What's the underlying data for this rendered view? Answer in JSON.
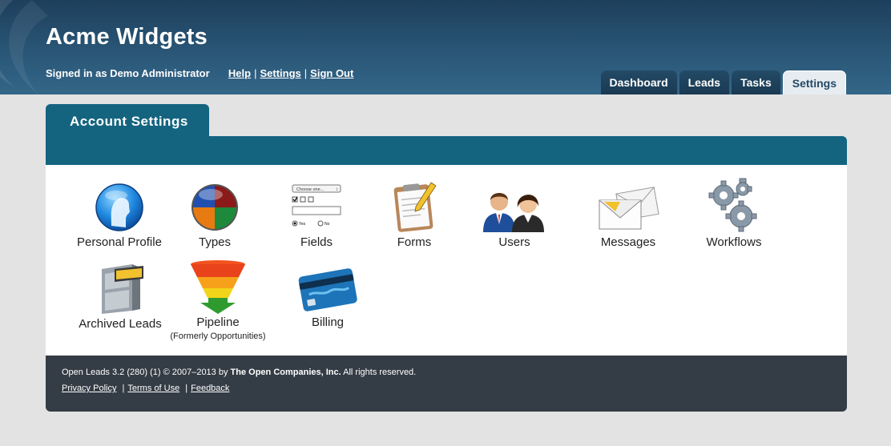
{
  "header": {
    "app_title": "Acme Widgets",
    "signed_in_text": "Signed in as Demo Administrator",
    "links": [
      "Help",
      "Settings",
      "Sign Out"
    ],
    "separator": "|"
  },
  "tabs": [
    {
      "label": "Dashboard",
      "active": false
    },
    {
      "label": "Leads",
      "active": false
    },
    {
      "label": "Tasks",
      "active": false
    },
    {
      "label": "Settings",
      "active": true
    }
  ],
  "panel": {
    "title": "Account Settings",
    "items": [
      {
        "label": "Personal Profile",
        "icon": "profile-icon"
      },
      {
        "label": "Types",
        "icon": "types-pie-icon"
      },
      {
        "label": "Fields",
        "icon": "fields-form-icon",
        "fields_icon_text": {
          "select": "Choose one...",
          "yes": "Yes",
          "no": "No"
        }
      },
      {
        "label": "Forms",
        "icon": "clipboard-icon"
      },
      {
        "label": "Users",
        "icon": "users-icon"
      },
      {
        "label": "Messages",
        "icon": "envelopes-icon"
      },
      {
        "label": "Workflows",
        "icon": "gears-icon"
      },
      {
        "label": "Archived Leads",
        "icon": "file-cabinet-icon"
      },
      {
        "label": "Pipeline",
        "sublabel": "(Formerly Opportunities)",
        "icon": "funnel-icon"
      },
      {
        "label": "Billing",
        "icon": "credit-card-icon"
      }
    ]
  },
  "footer": {
    "copyright_prefix": "Open Leads 3.2 (280) (1) © 2007–2013 by",
    "company": "The Open Companies, Inc.",
    "rights": "All rights reserved.",
    "links": [
      "Privacy Policy",
      "Terms of Use",
      "Feedback"
    ]
  },
  "colors": {
    "header_top": "#1d3f5c",
    "header_bottom": "#336688",
    "panel_teal": "#146480",
    "footer_bg": "#343c45",
    "page_bg": "#e3e3e3"
  }
}
